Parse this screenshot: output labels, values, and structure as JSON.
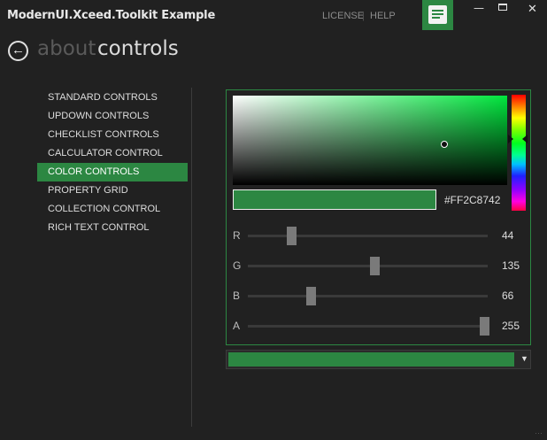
{
  "window": {
    "title": "ModernUI.Xceed.Toolkit Example",
    "links": [
      "LICENSE",
      "HELP"
    ],
    "link_separator": "|",
    "buttons": {
      "minimize": "minimize-icon",
      "maximize": "maximize-icon",
      "close": "close-icon"
    }
  },
  "breadcrumb": {
    "parent": "about",
    "current": "controls"
  },
  "nav": {
    "items": [
      "STANDARD CONTROLS",
      "UPDOWN CONTROLS",
      "CHECKLIST CONTROLS",
      "CALCULATOR CONTROL",
      "COLOR CONTROLS",
      "PROPERTY GRID",
      "COLLECTION CONTROL",
      "RICH TEXT CONTROL"
    ],
    "active_index": 4
  },
  "color_picker": {
    "hex": "#FF2C8742",
    "selected_color": "#2c8742",
    "hue_color": "#00e63d",
    "channels": [
      {
        "label": "R",
        "value": "44",
        "fraction": 0.173
      },
      {
        "label": "G",
        "value": "135",
        "fraction": 0.529
      },
      {
        "label": "B",
        "value": "66",
        "fraction": 0.259
      },
      {
        "label": "A",
        "value": "255",
        "fraction": 1.0
      }
    ]
  },
  "combo": {
    "color": "#2c8742",
    "arrow": "chevron-down-icon"
  },
  "colors": {
    "accent": "#2c8742",
    "background": "#212121"
  }
}
